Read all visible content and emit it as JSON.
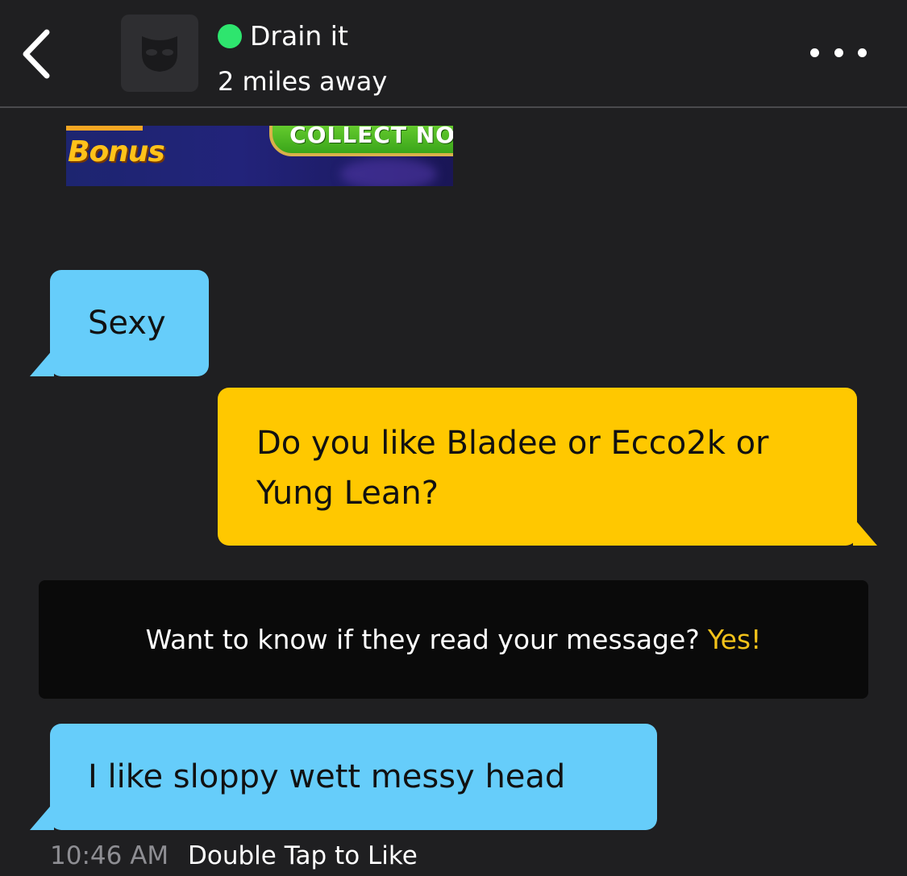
{
  "header": {
    "back_icon": "chevron-left-icon",
    "avatar_icon": "mask-icon",
    "name": "Drain it",
    "distance": "2 miles away",
    "online_color": "#2ee56e",
    "more_icon": "ellipsis-icon"
  },
  "ad": {
    "bonus_label": "Bonus",
    "cta_label": "COLLECT NOW"
  },
  "messages": [
    {
      "direction": "incoming",
      "text": "Sexy",
      "color": "#66cdfa"
    },
    {
      "direction": "outgoing",
      "text_line1": "Do you like Bladee or Ecco2k or",
      "text_line2": "Yung Lean?",
      "color": "#ffc800"
    },
    {
      "direction": "incoming",
      "text": "I like sloppy wett messy head",
      "color": "#66cdfa"
    }
  ],
  "promo": {
    "text": "Want to know if they read your message?",
    "cta": "Yes!",
    "cta_color": "#f2c21a"
  },
  "footer": {
    "timestamp": "10:46 AM",
    "hint": "Double Tap to Like"
  }
}
